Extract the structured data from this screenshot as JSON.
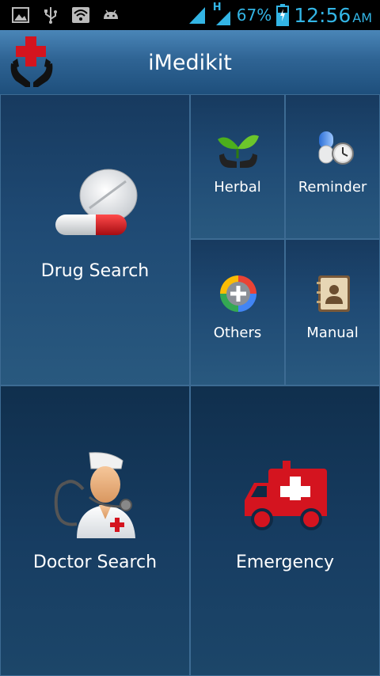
{
  "status_bar": {
    "battery_percent": "67%",
    "time": "12:56",
    "ampm": "AM",
    "network_type": "H",
    "icons": [
      "image-icon",
      "usb-icon",
      "wifi-icon",
      "android-icon",
      "signal-icon",
      "signal-h-icon",
      "battery-charging-icon"
    ]
  },
  "header": {
    "title": "iMedikit",
    "logo_icon": "medical-hands-icon"
  },
  "tiles": {
    "drug_search": "Drug Search",
    "herbal": "Herbal",
    "reminder": "Reminder",
    "others": "Others",
    "manual": "Manual",
    "doctor_search": "Doctor Search",
    "emergency": "Emergency"
  },
  "colors": {
    "status_accent": "#33b5e5",
    "header_top": "#4a86b8",
    "tile_bg": "#1f4a74",
    "medical_red": "#d4141f"
  }
}
